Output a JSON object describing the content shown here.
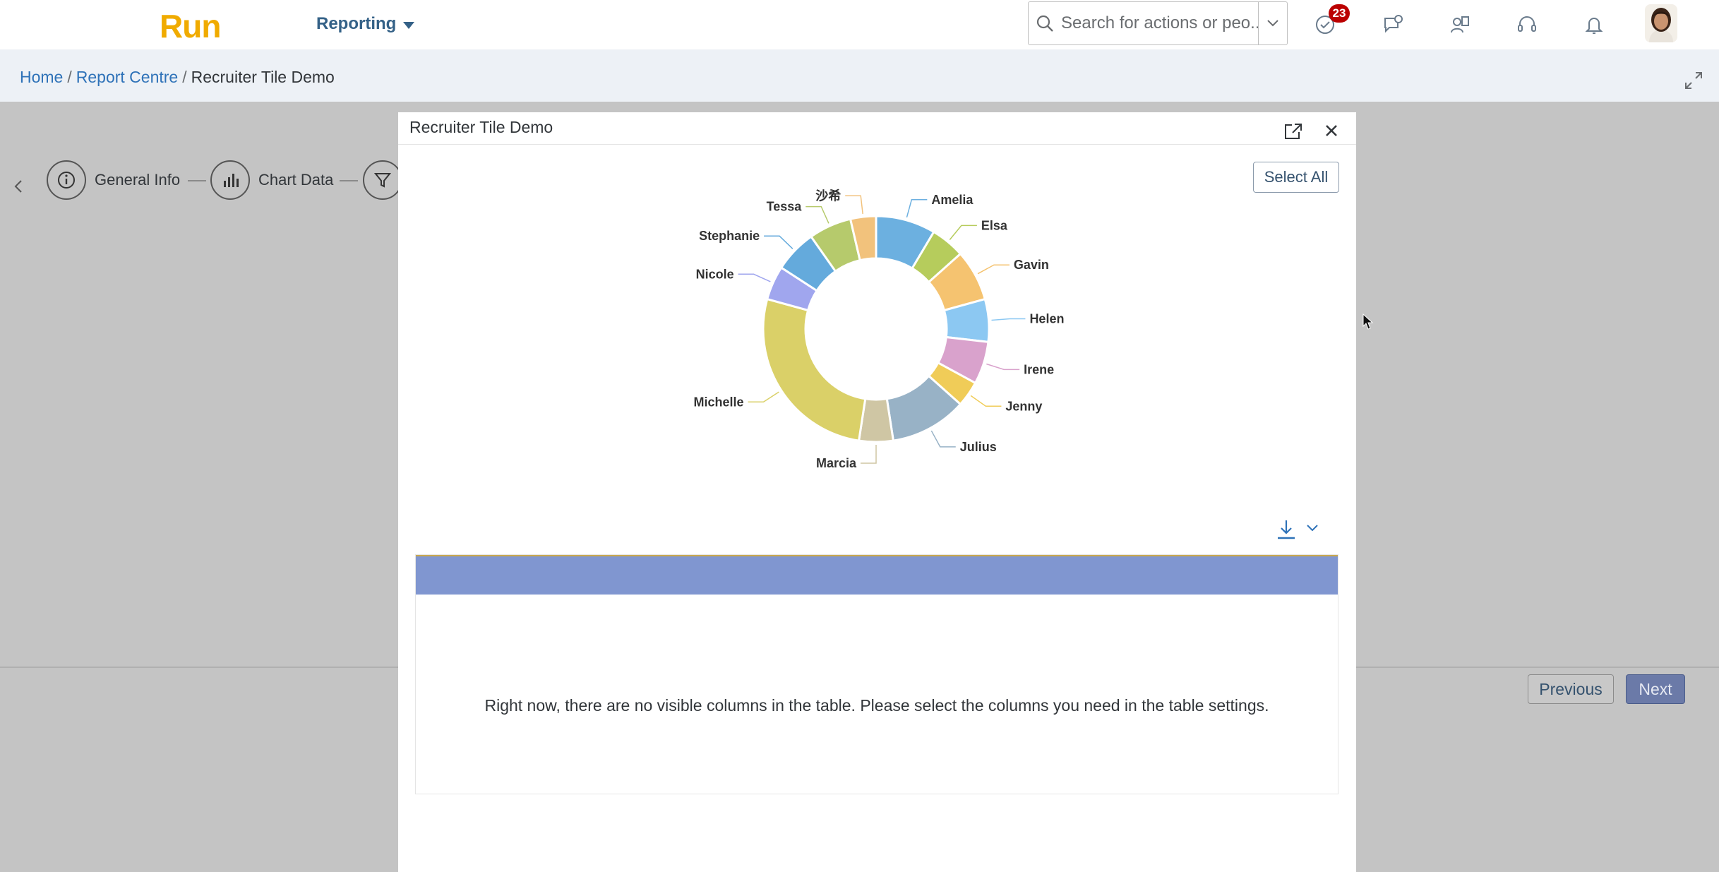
{
  "header": {
    "logo": "Run",
    "menu_label": "Reporting",
    "search_placeholder": "Search for actions or peo...",
    "notification_count": "23"
  },
  "breadcrumb": {
    "items": [
      "Home",
      "Report Centre"
    ],
    "current": "Recruiter Tile Demo"
  },
  "wizard": {
    "steps": [
      {
        "label": "General Info",
        "icon": "info-icon"
      },
      {
        "label": "Chart Data",
        "icon": "bar-chart-icon"
      },
      {
        "label": "",
        "icon": "filter-icon"
      }
    ],
    "previous_label": "Previous",
    "next_label": "Next"
  },
  "dialog": {
    "title": "Recruiter Tile Demo",
    "select_all_label": "Select All",
    "empty_table_message": "Right now, there are no visible columns in the table. Please select the columns you need in the table settings."
  },
  "colors": {
    "brand": "#f0ab00",
    "link": "#2e72b8",
    "table_header": "#8096d0",
    "badge": "#bb0000"
  },
  "chart_data": {
    "type": "pie",
    "donut": true,
    "categories": [
      "Amelia",
      "Elsa",
      "Gavin",
      "Helen",
      "Irene",
      "Jenny",
      "Julius",
      "Marcia",
      "Michelle",
      "Nicole",
      "Stephanie",
      "Tessa",
      "沙希"
    ],
    "values": [
      7,
      4,
      6,
      5,
      5,
      3,
      9,
      4,
      22,
      4,
      5,
      5,
      3
    ],
    "colors": [
      "#6cb0e0",
      "#b6cc5c",
      "#f5c370",
      "#8cc8f2",
      "#d9a2cc",
      "#f0cc58",
      "#98b2c6",
      "#cfc6a4",
      "#dad068",
      "#a0a6ee",
      "#64aadc",
      "#b6ca6c",
      "#f2c27c"
    ]
  }
}
